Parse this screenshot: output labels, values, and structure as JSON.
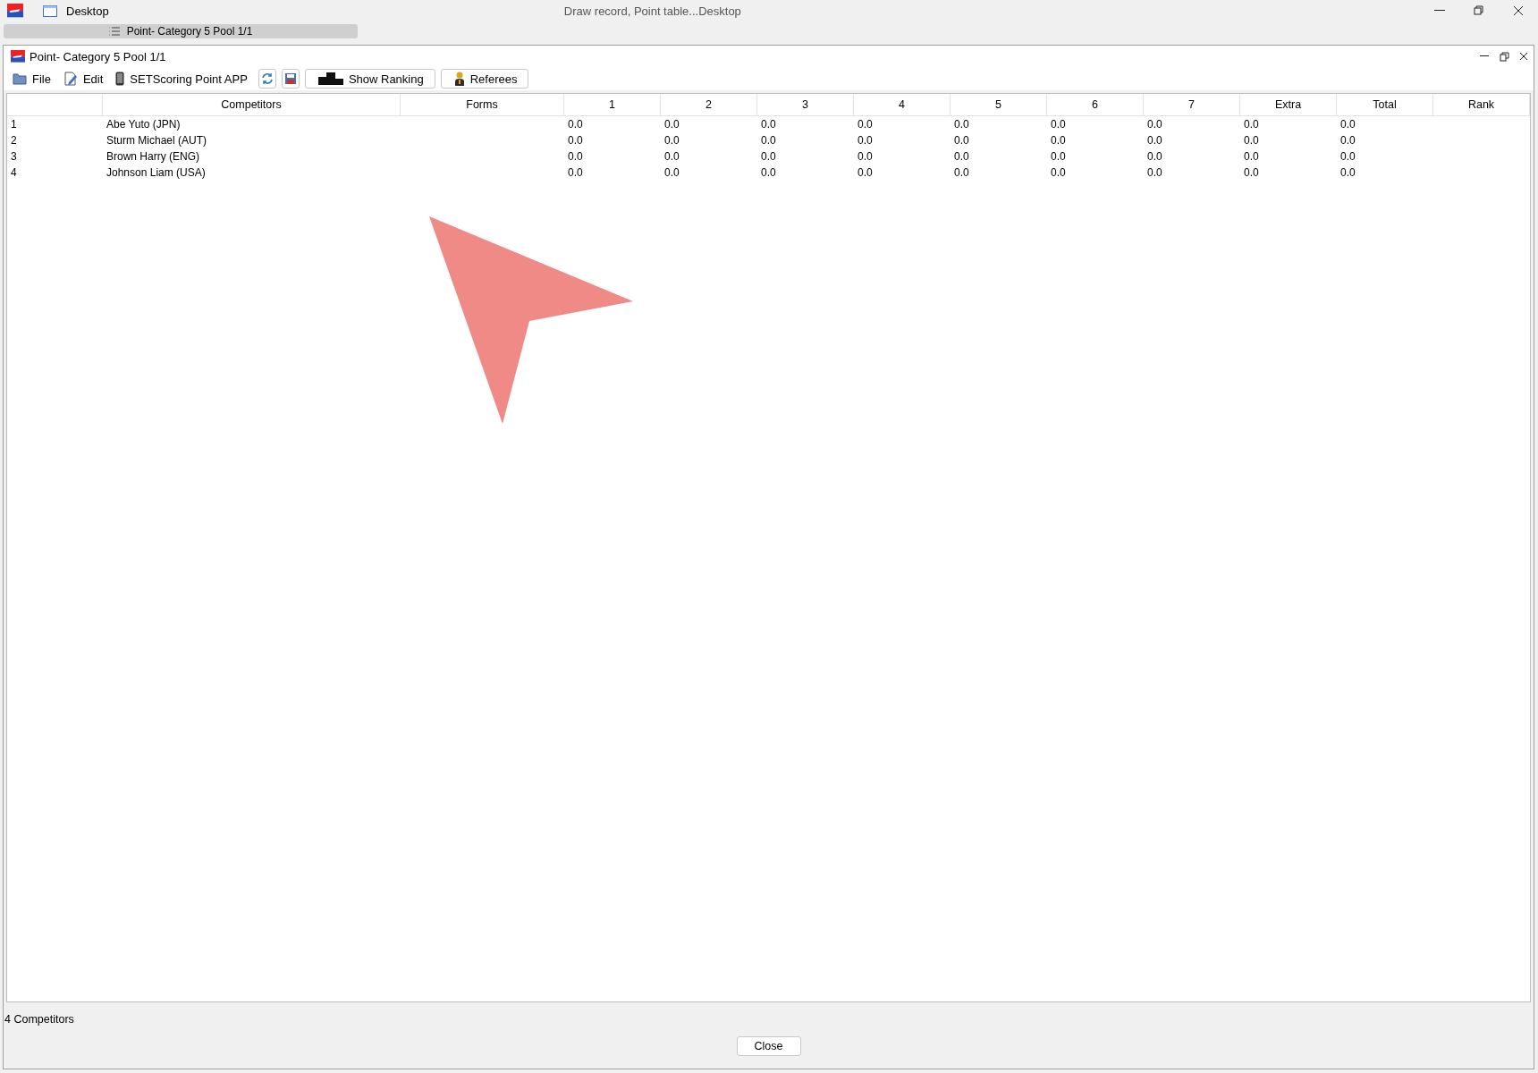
{
  "desktop_window": {
    "label": "Desktop",
    "title": "Draw record, Point table...Desktop"
  },
  "taskbar_tabs": [
    {
      "label": "Point- Category 5 Pool 1/1",
      "selected": true
    }
  ],
  "window": {
    "title": "Point- Category 5 Pool 1/1"
  },
  "toolbar": {
    "menu_items": [
      {
        "label": "File",
        "kind": "folder"
      },
      {
        "label": "Edit",
        "kind": "edit"
      },
      {
        "label": "SETScoring Point APP",
        "kind": "phone"
      }
    ],
    "buttons": [
      {
        "label": "Show Ranking",
        "kind": "podium"
      },
      {
        "label": "Referees",
        "kind": "person"
      }
    ]
  },
  "table": {
    "columns": [
      "",
      "Competitors",
      "Forms",
      "1",
      "2",
      "3",
      "4",
      "5",
      "6",
      "7",
      "Extra",
      "Total",
      "Rank"
    ],
    "rows": [
      {
        "number": "1",
        "name": "Abe Yuto (JPN)",
        "scores": [
          "0.0",
          "0.0",
          "0.0",
          "0.0",
          "0.0",
          "0.0",
          "0.0"
        ],
        "extra": "0.0",
        "total": "0.0"
      },
      {
        "number": "2",
        "name": "Sturm Michael (AUT)",
        "scores": [
          "0.0",
          "0.0",
          "0.0",
          "0.0",
          "0.0",
          "0.0",
          "0.0"
        ],
        "extra": "0.0",
        "total": "0.0"
      },
      {
        "number": "3",
        "name": "Brown Harry (ENG)",
        "scores": [
          "0.0",
          "0.0",
          "0.0",
          "0.0",
          "0.0",
          "0.0",
          "0.0"
        ],
        "extra": "0.0",
        "total": "0.0"
      },
      {
        "number": "4",
        "name": "Johnson Liam (USA)",
        "scores": [
          "0.0",
          "0.0",
          "0.0",
          "0.0",
          "0.0",
          "0.0",
          "0.0"
        ],
        "extra": "0.0",
        "total": "0.0"
      }
    ]
  },
  "status_bar": {
    "text": "4 Competitors"
  },
  "footer_buttons": [
    "Close"
  ]
}
